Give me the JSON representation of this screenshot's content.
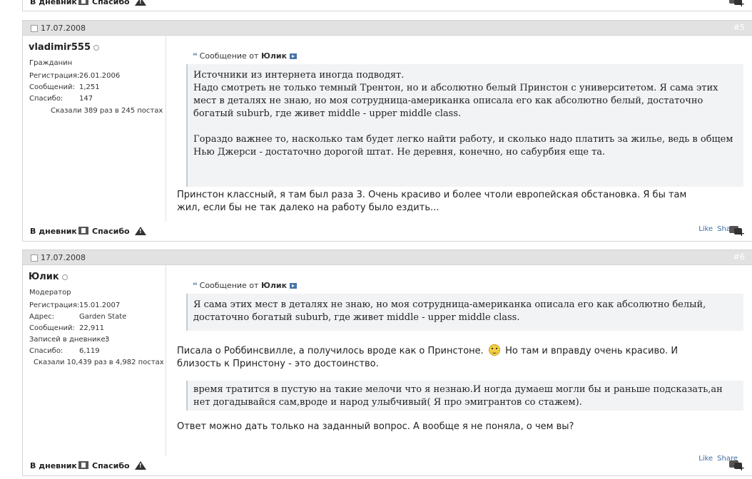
{
  "top_footer": {
    "blog_label": "В дневник",
    "thanks_label": "Спасибо"
  },
  "posts": [
    {
      "date": "17.07.2008",
      "number": "#5",
      "username": "vladimir555",
      "user_title": "Гражданин",
      "stats": [
        {
          "label": "Регистрация:",
          "value": "26.01.2006"
        },
        {
          "label": "Сообщений:",
          "value": "1,251"
        },
        {
          "label": "Спасибо:",
          "value": "147"
        }
      ],
      "thanks_summary": "Сказали 389 раз в 245 постах",
      "quotes": [
        {
          "header_prefix": "Сообщение от",
          "author": "Юлик",
          "lines": [
            "Источники из интернета иногда подводят.",
            "Надо смотреть не только темный Трентон, но и абсолютно белый Принстон с университетом. Я сама этих",
            "мест в деталях не знаю, но моя сотрудница-американка описала его как абсолютно белый, достаточно",
            "богатый suburb, где живет middle - upper middle class.",
            "",
            "Гораздо важнее то, насколько там будет легко найти работу, и сколько надо платить за жилье, ведь в общем",
            "Нью Джерси - достаточно дорогой штат. Не деревня, конечно, но сабурбия еще та."
          ]
        }
      ],
      "body": [
        "Принстон классный, я там был раза 3. Очень красиво и более чтоли европейская обстановка. Я бы там",
        "жил, если бы не так далеко на работу было ездить..."
      ],
      "like_label": "Like",
      "share_label": "Share",
      "blog_label": "В дневник",
      "thanks_label": "Спасибо"
    },
    {
      "date": "17.07.2008",
      "number": "#6",
      "username": "Юлик",
      "user_title": "Модератор",
      "stats": [
        {
          "label": "Регистрация:",
          "value": "15.01.2007"
        },
        {
          "label": "Адрес:",
          "value": "Garden State"
        },
        {
          "label": "Сообщений:",
          "value": "22,911"
        },
        {
          "label": "Записей в дневнике:",
          "value": "3"
        },
        {
          "label": "Спасибо:",
          "value": "6,119"
        }
      ],
      "thanks_summary": "Сказали 10,439 раз в 4,982 постах",
      "quotes": [
        {
          "header_prefix": "Сообщение от",
          "author": "Юлик",
          "lines": [
            "Я сама этих мест в деталях не знаю, но моя сотрудница-американка описала его как абсолютно белый,",
            "достаточно богатый suburb, где живет middle - upper middle class."
          ]
        }
      ],
      "body_line1_part1": "Писала о Роббинсвилле, а получилось вроде как о Принстоне.",
      "body_line1_part2": "Но там и вправду очень красиво. И",
      "body_line2": "близость к Принстону - это достоинство.",
      "quote2_lines": [
        "время тратится в пустую на такие мелочи что я незнаю.И ногда думаеш могли бы и раньше подсказать,ан",
        "нет догадывайся сам,вроде и народ улыбчивый( Я про эмигрантов со стажем)."
      ],
      "body_last": "Ответ можно дать только на заданный вопрос. А вообще я не поняла, о чем вы?",
      "like_label": "Like",
      "share_label": "Share",
      "blog_label": "В дневник",
      "thanks_label": "Спасибо"
    }
  ]
}
